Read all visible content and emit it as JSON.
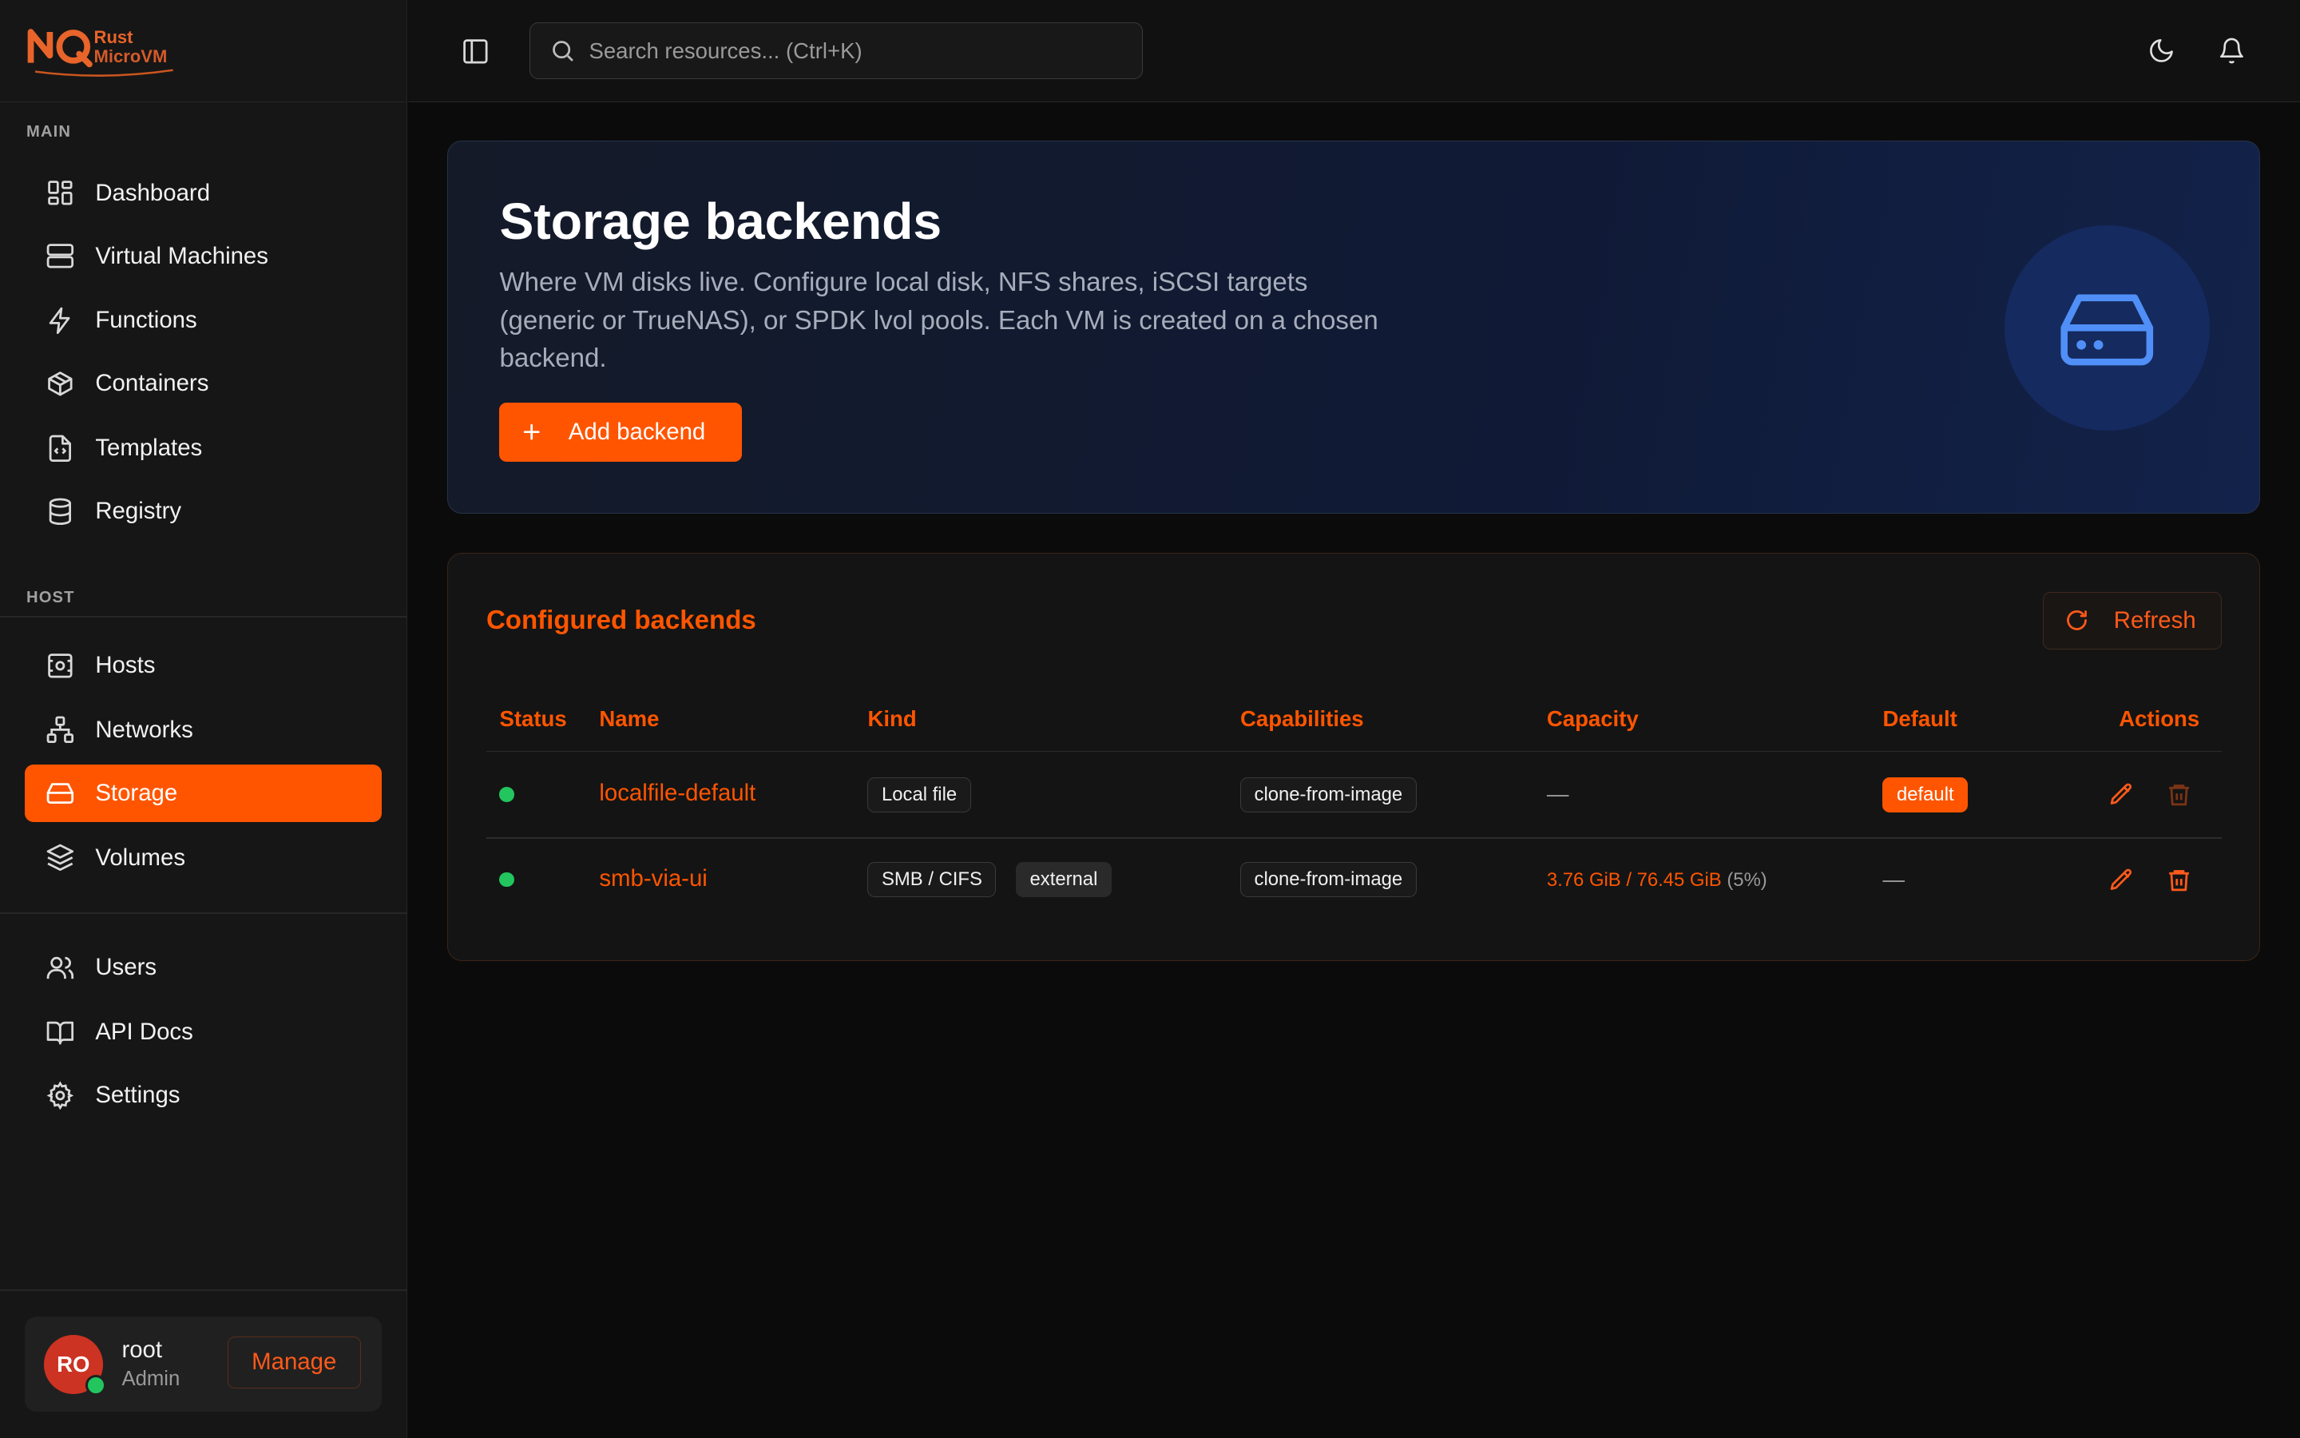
{
  "app": {
    "logo_line1": "Rust",
    "logo_line2": "MicroVM",
    "accent_color": "#ff5500"
  },
  "sidebar": {
    "main_label": "MAIN",
    "host_label": "HOST",
    "main_items": [
      {
        "label": "Dashboard",
        "icon": "dashboard-icon"
      },
      {
        "label": "Virtual Machines",
        "icon": "server-icon"
      },
      {
        "label": "Functions",
        "icon": "lightning-icon"
      },
      {
        "label": "Containers",
        "icon": "box-icon"
      },
      {
        "label": "Templates",
        "icon": "file-code-icon"
      },
      {
        "label": "Registry",
        "icon": "database-icon"
      }
    ],
    "host_items": [
      {
        "label": "Hosts",
        "icon": "host-icon"
      },
      {
        "label": "Networks",
        "icon": "network-icon"
      },
      {
        "label": "Storage",
        "icon": "hard-drive-icon",
        "active": true
      },
      {
        "label": "Volumes",
        "icon": "layers-icon"
      }
    ],
    "other_items": [
      {
        "label": "Users",
        "icon": "users-icon"
      },
      {
        "label": "API Docs",
        "icon": "book-icon"
      },
      {
        "label": "Settings",
        "icon": "gear-icon"
      }
    ],
    "user": {
      "initials": "RO",
      "name": "root",
      "role": "Admin",
      "manage_label": "Manage"
    }
  },
  "topbar": {
    "search_placeholder": "Search resources... (Ctrl+K)"
  },
  "hero": {
    "title": "Storage backends",
    "description": "Where VM disks live. Configure local disk, NFS shares, iSCSI targets (generic or TrueNAS), or SPDK lvol pools. Each VM is created on a chosen backend.",
    "add_label": "Add backend"
  },
  "backends": {
    "title": "Configured backends",
    "refresh_label": "Refresh",
    "columns": [
      "Status",
      "Name",
      "Kind",
      "Capabilities",
      "Capacity",
      "Default",
      "Actions"
    ],
    "rows": [
      {
        "status": "online",
        "name": "localfile-default",
        "kind": [
          "Local file"
        ],
        "capabilities": [
          "clone-from-image"
        ],
        "capacity": "—",
        "capacity_pct": "",
        "default": "default"
      },
      {
        "status": "online",
        "name": "smb-via-ui",
        "kind": [
          "SMB / CIFS",
          "external"
        ],
        "capabilities": [
          "clone-from-image"
        ],
        "capacity": "3.76 GiB / 76.45 GiB",
        "capacity_pct": "(5%)",
        "default": "—"
      }
    ]
  }
}
